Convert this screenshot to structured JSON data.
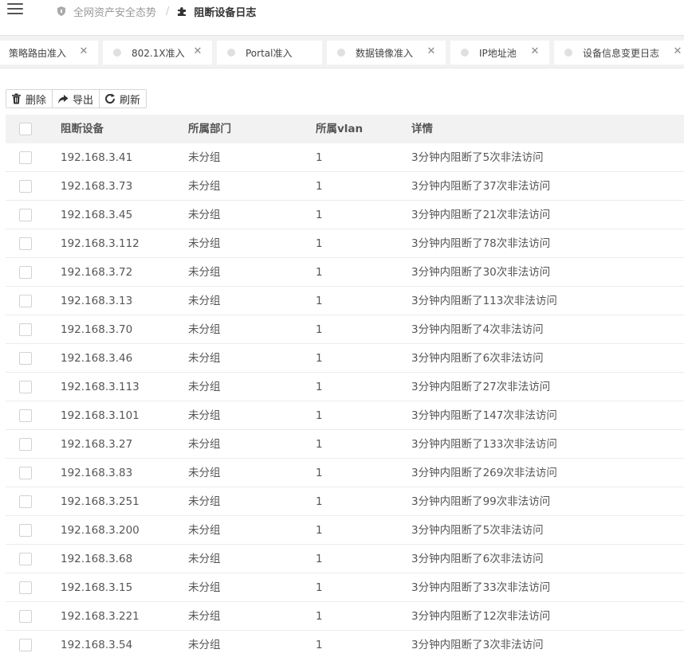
{
  "header": {
    "menu_icon": "hamburger-menu-icon",
    "breadcrumb": [
      {
        "label": "全网资产安全态势",
        "icon": "shield-icon"
      },
      {
        "label": "阻断设备日志",
        "icon": "puzzle-icon"
      }
    ],
    "separator": "/"
  },
  "tabs": [
    {
      "label": "策略路由准入"
    },
    {
      "label": "802.1X准入"
    },
    {
      "label": "Portal准入"
    },
    {
      "label": "数据镜像准入"
    },
    {
      "label": "IP地址池"
    },
    {
      "label": "设备信息变更日志"
    }
  ],
  "toolbar": {
    "delete_label": "删除",
    "export_label": "导出",
    "refresh_label": "刷新"
  },
  "table": {
    "columns": [
      "阻断设备",
      "所属部门",
      "所属vlan",
      "详情"
    ],
    "rows": [
      {
        "device": "192.168.3.41",
        "dept": "未分组",
        "vlan": "1",
        "detail": "3分钟内阻断了5次非法访问"
      },
      {
        "device": "192.168.3.73",
        "dept": "未分组",
        "vlan": "1",
        "detail": "3分钟内阻断了37次非法访问"
      },
      {
        "device": "192.168.3.45",
        "dept": "未分组",
        "vlan": "1",
        "detail": "3分钟内阻断了21次非法访问"
      },
      {
        "device": "192.168.3.112",
        "dept": "未分组",
        "vlan": "1",
        "detail": "3分钟内阻断了78次非法访问"
      },
      {
        "device": "192.168.3.72",
        "dept": "未分组",
        "vlan": "1",
        "detail": "3分钟内阻断了30次非法访问"
      },
      {
        "device": "192.168.3.13",
        "dept": "未分组",
        "vlan": "1",
        "detail": "3分钟内阻断了113次非法访问"
      },
      {
        "device": "192.168.3.70",
        "dept": "未分组",
        "vlan": "1",
        "detail": "3分钟内阻断了4次非法访问"
      },
      {
        "device": "192.168.3.46",
        "dept": "未分组",
        "vlan": "1",
        "detail": "3分钟内阻断了6次非法访问"
      },
      {
        "device": "192.168.3.113",
        "dept": "未分组",
        "vlan": "1",
        "detail": "3分钟内阻断了27次非法访问"
      },
      {
        "device": "192.168.3.101",
        "dept": "未分组",
        "vlan": "1",
        "detail": "3分钟内阻断了147次非法访问"
      },
      {
        "device": "192.168.3.27",
        "dept": "未分组",
        "vlan": "1",
        "detail": "3分钟内阻断了133次非法访问"
      },
      {
        "device": "192.168.3.83",
        "dept": "未分组",
        "vlan": "1",
        "detail": "3分钟内阻断了269次非法访问"
      },
      {
        "device": "192.168.3.251",
        "dept": "未分组",
        "vlan": "1",
        "detail": "3分钟内阻断了99次非法访问"
      },
      {
        "device": "192.168.3.200",
        "dept": "未分组",
        "vlan": "1",
        "detail": "3分钟内阻断了5次非法访问"
      },
      {
        "device": "192.168.3.68",
        "dept": "未分组",
        "vlan": "1",
        "detail": "3分钟内阻断了6次非法访问"
      },
      {
        "device": "192.168.3.15",
        "dept": "未分组",
        "vlan": "1",
        "detail": "3分钟内阻断了33次非法访问"
      },
      {
        "device": "192.168.3.221",
        "dept": "未分组",
        "vlan": "1",
        "detail": "3分钟内阻断了12次非法访问"
      },
      {
        "device": "192.168.3.54",
        "dept": "未分组",
        "vlan": "1",
        "detail": "3分钟内阻断了3次非法访问"
      }
    ]
  }
}
